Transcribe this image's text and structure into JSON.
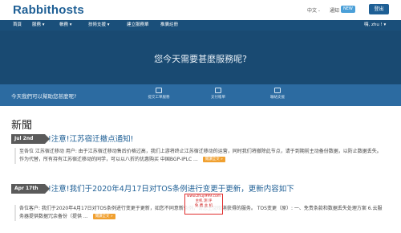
{
  "header": {
    "logo": "Rabbithosts",
    "language": "中文 -",
    "notifications": "通知",
    "notifications_badge": "NEW",
    "logout": "登出"
  },
  "nav": {
    "items": [
      "首頁",
      "服務 ▾",
      "帳務 ▾",
      "技術支援 ▾",
      "建立服務單",
      "推廣註冊"
    ],
    "user": "嗨, zhu ! ▾"
  },
  "hero": {
    "title": "您今天需要甚麼服務呢?"
  },
  "help": {
    "text": "今天我們可以幫助您甚麼呢?",
    "buttons": [
      "提交工單服務",
      "支付帳單",
      "聯絡支援"
    ]
  },
  "news": {
    "heading": "新聞",
    "read_more": "閱讀全文 »",
    "items": [
      {
        "date": "Jul 2nd",
        "title": "!注意!江苏宿迁撤点通知!",
        "body": "至各位 江苏宿迁移动 用户:   由于江苏宿迁移动售后价格过高，我们上游将终止江苏宿迁移动的运营，同时我们将撤除此节点，请于到期前主动备份数据，以防止数据丢失。 作为代替，所有持有江苏宿迁移动的同学，可以以八折的优惠购买 中国BGP-IPLC ..."
      },
      {
        "date": "Apr 17th",
        "title": "!注意!我们于2020年4月17日对TOS条例进行变更于更新，更新内容如下",
        "body": "各位客户:   我们于2020年4月17日对TOS条例进行变更于更新，如您不同意新条例，请您主动取消获得的服务。   TOS变更（原）: 一、免责条款和数据丢失处理方案 6.云服务器提供数据冗余备份（提供 ..."
      }
    ]
  },
  "watermark": {
    "lines": [
      "www.zhuji999.com",
      "主机 测 评",
      "免 费 主 机"
    ]
  },
  "colors": {
    "brand": "#1e5f95",
    "nav_bg": "#1a4f7a",
    "hero_bg": "#194a72",
    "help_bg": "#2c6ba1",
    "read_more": "#f0a030"
  }
}
